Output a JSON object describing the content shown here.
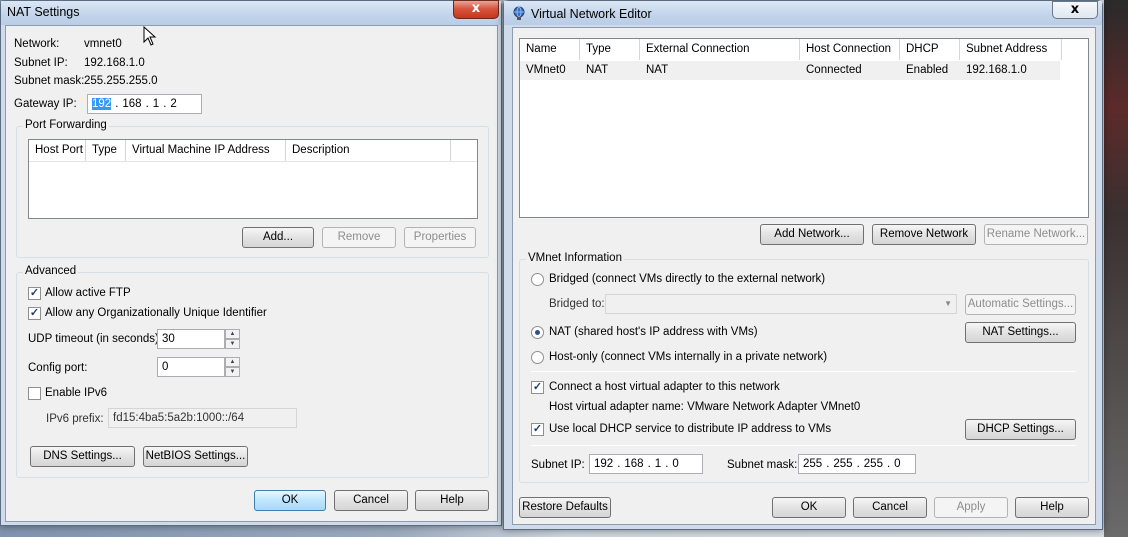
{
  "nat": {
    "title": "NAT Settings",
    "close_glyph": "x",
    "network_label": "Network:",
    "network_value": "vmnet0",
    "subnet_ip_label": "Subnet IP:",
    "subnet_ip_value": "192.168.1.0",
    "subnet_mask_label": "Subnet mask:",
    "subnet_mask_value": "255.255.255.0",
    "gateway_label": "Gateway IP:",
    "gateway_octets": [
      "192",
      "168",
      "1",
      "2"
    ],
    "port_forwarding": {
      "title": "Port Forwarding",
      "columns": [
        "Host Port",
        "Type",
        "Virtual Machine IP Address",
        "Description"
      ],
      "add": "Add...",
      "remove": "Remove",
      "properties": "Properties"
    },
    "advanced": {
      "title": "Advanced",
      "allow_ftp": "Allow active FTP",
      "allow_oui": "Allow any Organizationally Unique Identifier",
      "udp_label": "UDP timeout (in seconds):",
      "udp_value": "30",
      "config_label": "Config port:",
      "config_value": "0",
      "ipv6_enable": "Enable IPv6",
      "ipv6_prefix_label": "IPv6 prefix:",
      "ipv6_prefix_value": "fd15:4ba5:5a2b:1000::/64",
      "dns": "DNS Settings...",
      "netbios": "NetBIOS Settings..."
    },
    "ok": "OK",
    "cancel": "Cancel",
    "help": "Help"
  },
  "vne": {
    "title": "Virtual Network Editor",
    "close_glyph": "x",
    "columns": [
      "Name",
      "Type",
      "External Connection",
      "Host Connection",
      "DHCP",
      "Subnet Address"
    ],
    "rows": [
      [
        "VMnet0",
        "NAT",
        "NAT",
        "Connected",
        "Enabled",
        "192.168.1.0"
      ]
    ],
    "add_network": "Add Network...",
    "remove_network": "Remove Network",
    "rename_network": "Rename Network...",
    "info": {
      "title": "VMnet Information",
      "bridged": "Bridged (connect VMs directly to the external network)",
      "bridged_to": "Bridged to:",
      "auto_settings": "Automatic Settings...",
      "nat": "NAT (shared host's IP address with VMs)",
      "nat_settings": "NAT Settings...",
      "hostonly": "Host-only (connect VMs internally in a private network)",
      "connect_adapter": "Connect a host virtual adapter to this network",
      "adapter_name": "Host virtual adapter name: VMware Network Adapter VMnet0",
      "use_dhcp": "Use local DHCP service to distribute IP address to VMs",
      "dhcp_settings": "DHCP Settings...",
      "subnet_ip_label": "Subnet IP:",
      "subnet_ip_octets": [
        "192",
        "168",
        "1",
        "0"
      ],
      "subnet_mask_label": "Subnet mask:",
      "subnet_mask_octets": [
        "255",
        "255",
        "255",
        "0"
      ]
    },
    "restore": "Restore Defaults",
    "ok": "OK",
    "cancel": "Cancel",
    "apply": "Apply",
    "help": "Help"
  },
  "colors": {
    "selection": "#3399ff",
    "title_bar": "#c2d4ea",
    "close": "#c7361c"
  }
}
